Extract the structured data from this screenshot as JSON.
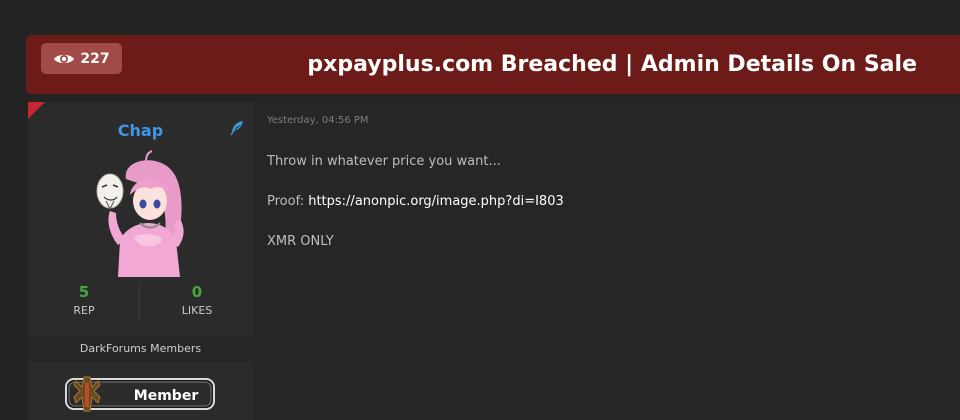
{
  "thread": {
    "view_count": "227",
    "title": "pxpayplus.com Breached | Admin Details On Sale"
  },
  "author": {
    "username": "Chap",
    "rep_value": "5",
    "rep_label": "REP",
    "likes_value": "0",
    "likes_label": "LIKES",
    "usergroup": "DarkForums Members",
    "rank_label": "Member"
  },
  "post": {
    "date": "Yesterday, 04:56 PM",
    "line1": "Throw in whatever price you want...",
    "proof_label": "Proof:",
    "proof_link": "https://anonpic.org/image.php?di=I803",
    "line3": "XMR ONLY"
  },
  "colors": {
    "header_bg": "#6d1b18",
    "badge_bg": "#a24a46",
    "username": "#3f96e6",
    "stat_green": "#46a83f"
  },
  "icons": [
    "eye-icon",
    "feather-icon",
    "corner-flag"
  ]
}
